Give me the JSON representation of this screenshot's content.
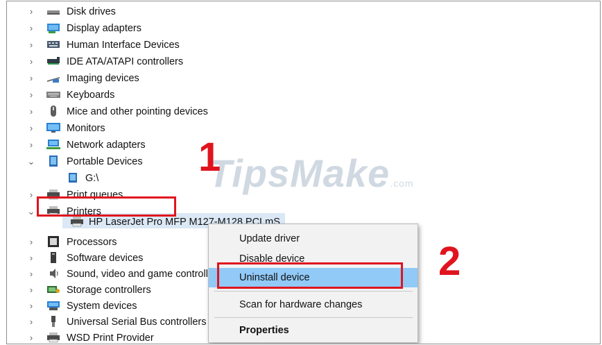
{
  "tree": {
    "items": [
      {
        "label": "Disk drives",
        "icon": "disk-drive-icon",
        "chevron": "›"
      },
      {
        "label": "Display adapters",
        "icon": "display-adapter-icon",
        "chevron": "›"
      },
      {
        "label": "Human Interface Devices",
        "icon": "hid-icon",
        "chevron": "›"
      },
      {
        "label": "IDE ATA/ATAPI controllers",
        "icon": "ide-controller-icon",
        "chevron": "›"
      },
      {
        "label": "Imaging devices",
        "icon": "imaging-device-icon",
        "chevron": "›"
      },
      {
        "label": "Keyboards",
        "icon": "keyboard-icon",
        "chevron": "›"
      },
      {
        "label": "Mice and other pointing devices",
        "icon": "mouse-icon",
        "chevron": "›"
      },
      {
        "label": "Monitors",
        "icon": "monitor-icon",
        "chevron": "›"
      },
      {
        "label": "Network adapters",
        "icon": "network-adapter-icon",
        "chevron": "›"
      },
      {
        "label": "Portable Devices",
        "icon": "portable-device-icon",
        "chevron": "⌄"
      },
      {
        "label": "G:\\",
        "icon": "portable-drive-icon",
        "chevron": ""
      },
      {
        "label": "Print queues",
        "icon": "print-queue-icon",
        "chevron": "›"
      },
      {
        "label": "Printers",
        "icon": "printer-icon",
        "chevron": "⌄"
      },
      {
        "label": "HP LaserJet Pro MFP M127-M128 PCLmS",
        "icon": "printer-device-icon",
        "chevron": ""
      },
      {
        "label": "Processors",
        "icon": "processor-icon",
        "chevron": "›"
      },
      {
        "label": "Software devices",
        "icon": "software-device-icon",
        "chevron": "›"
      },
      {
        "label": "Sound, video and game controllers",
        "icon": "sound-icon",
        "chevron": "›"
      },
      {
        "label": "Storage controllers",
        "icon": "storage-controller-icon",
        "chevron": "›"
      },
      {
        "label": "System devices",
        "icon": "system-device-icon",
        "chevron": "›"
      },
      {
        "label": "Universal Serial Bus controllers",
        "icon": "usb-icon",
        "chevron": "›"
      },
      {
        "label": "WSD Print Provider",
        "icon": "wsd-printer-icon",
        "chevron": "›"
      }
    ]
  },
  "context_menu": {
    "items": [
      {
        "label": "Update driver"
      },
      {
        "label": "Disable device"
      },
      {
        "label": "Uninstall device"
      },
      {
        "label": "Scan for hardware changes"
      },
      {
        "label": "Properties"
      }
    ]
  },
  "annotations": {
    "step1": "1",
    "step2": "2",
    "watermark": "TipsMake",
    "watermark_suffix": ".com"
  },
  "colors": {
    "accent_red": "#e0141e",
    "selection_blue": "#91c9f7",
    "row_highlight": "#dbe8f5"
  }
}
